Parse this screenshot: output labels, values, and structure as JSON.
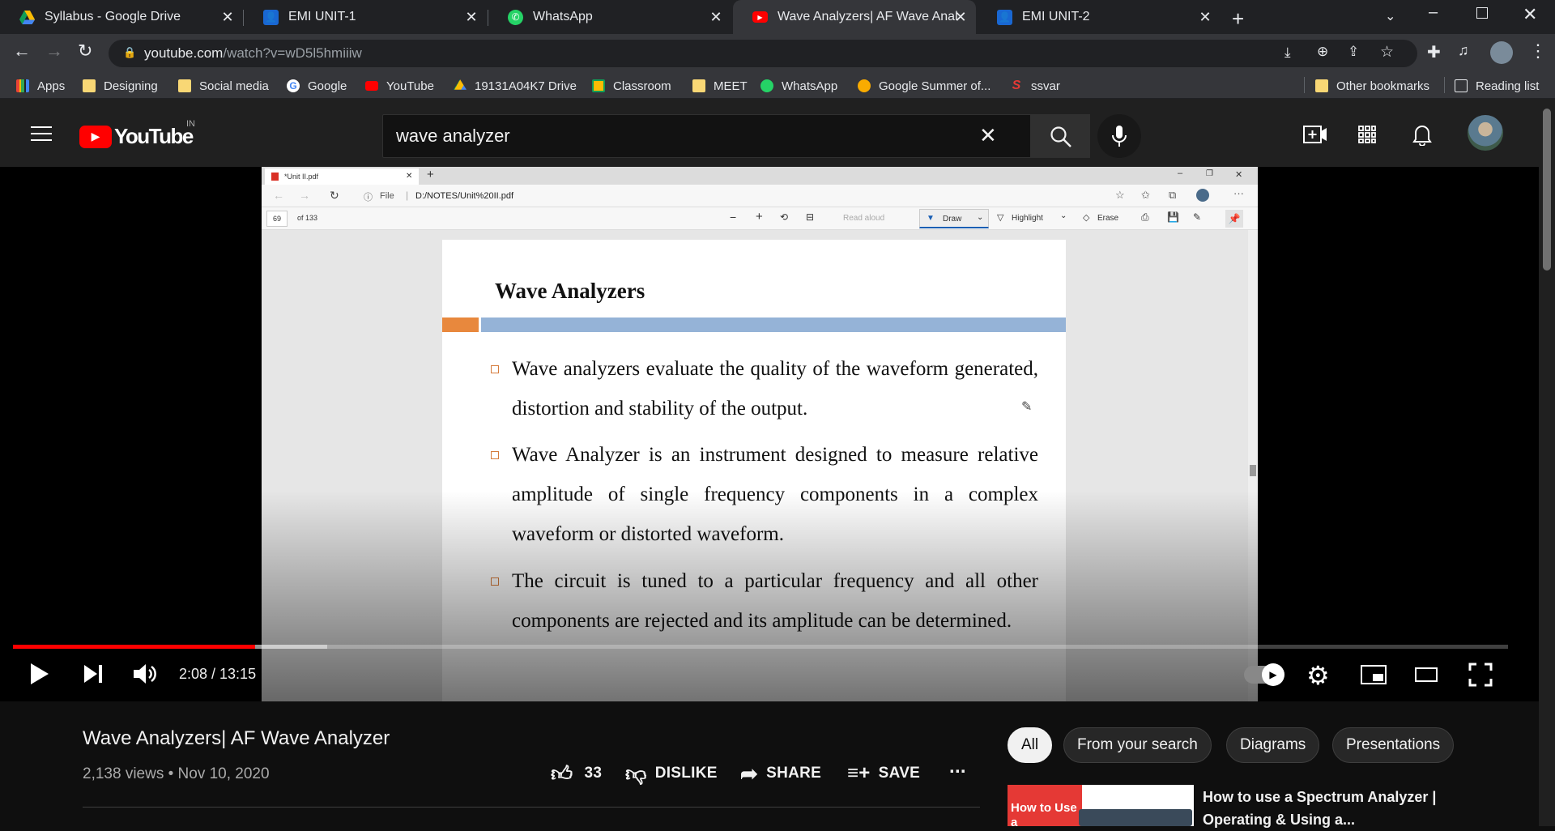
{
  "browser": {
    "tabs": [
      {
        "title": "Syllabus - Google Drive",
        "icon": "google-drive-icon",
        "active": false
      },
      {
        "title": "EMI UNIT-1",
        "icon": "google-classroom-icon",
        "active": false
      },
      {
        "title": "WhatsApp",
        "icon": "whatsapp-icon",
        "active": false
      },
      {
        "title": "Wave Analyzers| AF Wave Analyzer",
        "icon": "youtube-icon",
        "active": true
      },
      {
        "title": "EMI UNIT-2",
        "icon": "google-classroom-icon",
        "active": false
      }
    ],
    "url_host": "youtube.com",
    "url_path": "/watch?v=wD5l5hmiiiw",
    "bookmarks": [
      {
        "label": "Apps",
        "icon": "apps-grid-icon"
      },
      {
        "label": "Designing",
        "icon": "folder-icon"
      },
      {
        "label": "Social media",
        "icon": "folder-icon"
      },
      {
        "label": "Google",
        "icon": "google-icon"
      },
      {
        "label": "YouTube",
        "icon": "youtube-icon"
      },
      {
        "label": "19131A04K7 Drive",
        "icon": "google-drive-icon"
      },
      {
        "label": "Classroom",
        "icon": "google-classroom-icon"
      },
      {
        "label": "MEET",
        "icon": "folder-icon"
      },
      {
        "label": "WhatsApp",
        "icon": "whatsapp-icon"
      },
      {
        "label": "Google Summer of...",
        "icon": "gsoc-icon"
      },
      {
        "label": "ssvar",
        "icon": "s-logo-icon"
      }
    ],
    "other_bookmarks": "Other bookmarks",
    "reading_list": "Reading list"
  },
  "youtube": {
    "logo_text": "YouTube",
    "country": "IN",
    "search_query": "wave analyzer",
    "colors": {
      "brand_red": "#ff0000",
      "progress_red": "#ff0000"
    }
  },
  "video": {
    "pdf_viewer": {
      "tab_title": "*Unit II.pdf",
      "file_label": "File",
      "path": "D:/NOTES/Unit%20II.pdf",
      "page_number": "69",
      "page_total": "of 133",
      "read_aloud": "Read aloud",
      "draw": "Draw",
      "highlight": "Highlight",
      "erase": "Erase"
    },
    "slide": {
      "title": "Wave Analyzers",
      "bullets": [
        "Wave analyzers evaluate the quality of the waveform generated, distortion and stability of the output.",
        "Wave Analyzer is an instrument designed to measure relative amplitude of single frequency components in a complex waveform or distorted waveform.",
        "The circuit is tuned to a particular frequency and all other components are rejected and its amplitude can be determined."
      ]
    },
    "time": "2:08 / 13:15",
    "progress_played": 0.162,
    "progress_buffered": 0.21,
    "title": "Wave Analyzers| AF Wave Analyzer",
    "views_date": "2,138 views • Nov 10, 2020",
    "likes": "33",
    "dislike": "DISLIKE",
    "share": "SHARE",
    "save": "SAVE",
    "more": "..."
  },
  "sidebar": {
    "chips": [
      "All",
      "From your search",
      "Diagrams",
      "Presentations"
    ],
    "recommended": {
      "thumb_text": "How to Use a",
      "title": "How to use a Spectrum Analyzer | Operating & Using a..."
    }
  }
}
